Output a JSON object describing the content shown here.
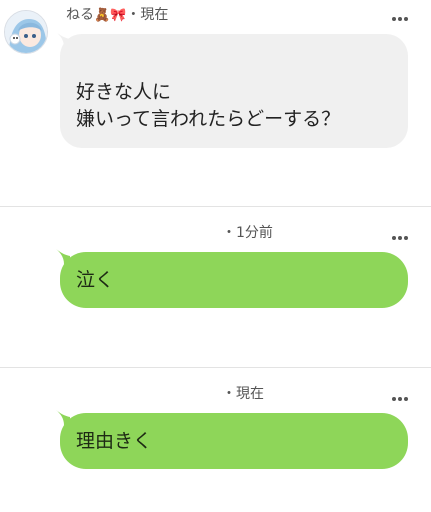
{
  "posts": [
    {
      "author": "ねる",
      "author_emoji": "🧸🎀",
      "separator": "・",
      "time": "現在",
      "lines": [
        "好きな人に",
        "嫌いって言われたらどーする？"
      ],
      "bubble_color": "#f0f0f0"
    },
    {
      "separator": "・",
      "time": "1分前",
      "lines": [
        "泣く"
      ],
      "bubble_color": "#8ed659"
    },
    {
      "separator": "・",
      "time": "現在",
      "lines": [
        "理由きく"
      ],
      "bubble_color": "#8ed659"
    }
  ],
  "icons": {
    "more": "more-horizontal-icon",
    "avatar": "user-avatar"
  },
  "colors": {
    "green_bubble": "#8ed659",
    "gray_bubble": "#f0f0f0",
    "divider": "#e3e3e3"
  }
}
